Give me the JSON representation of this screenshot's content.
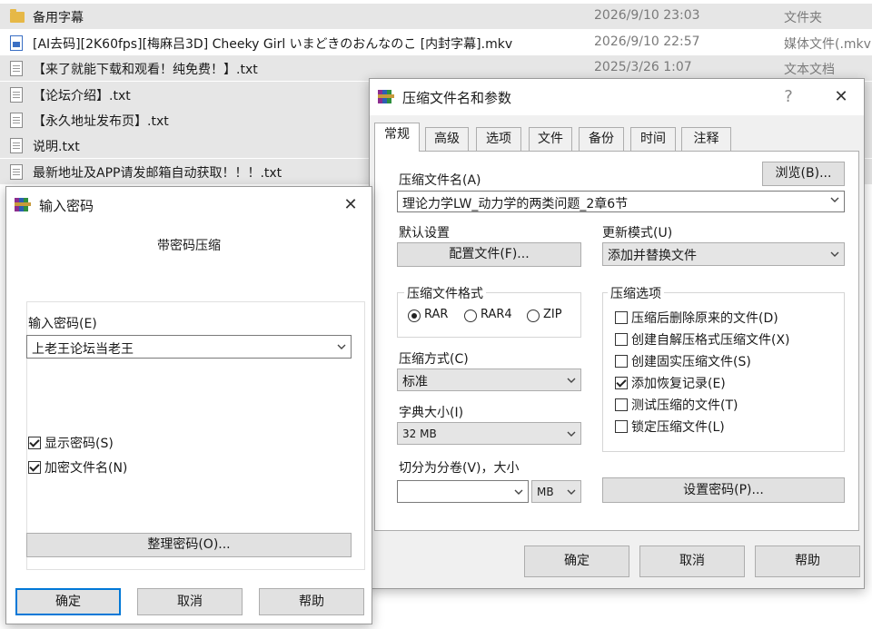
{
  "file_list": [
    {
      "name": "备用字幕",
      "date": "2026/9/10 23:03",
      "type": "文件夹",
      "icon": "folder-icon"
    },
    {
      "name": "[AI去码][2K60fps][梅麻吕3D] Cheeky Girl いまどきのおんなのこ [内封字幕].mkv",
      "date": "2026/9/10 22:57",
      "type": "媒体文件(.mkv",
      "icon": "media-file-icon"
    },
    {
      "name": "【来了就能下载和观看！纯免费！】.txt",
      "date": "2025/3/26 1:07",
      "type": "文本文档",
      "icon": "text-file-icon"
    },
    {
      "name": "【论坛介绍】.txt",
      "date": "",
      "type": "",
      "icon": "text-file-icon"
    },
    {
      "name": "【永久地址发布页】.txt",
      "date": "",
      "type": "",
      "icon": "text-file-icon"
    },
    {
      "name": "说明.txt",
      "date": "",
      "type": "",
      "icon": "text-file-icon"
    },
    {
      "name": "最新地址及APP请发邮箱自动获取！！！.txt",
      "date": "",
      "type": "",
      "icon": "text-file-icon"
    }
  ],
  "archive_dialog": {
    "title": "压缩文件名和参数",
    "help_button": "?",
    "close_button": "✕",
    "tabs": [
      "常规",
      "高级",
      "选项",
      "文件",
      "备份",
      "时间",
      "注释"
    ],
    "archive_name_label": "压缩文件名(A)",
    "browse_button": "浏览(B)...",
    "archive_name_value": "理论力学LW_动力学的两类问题_2章6节",
    "default_settings_label": "默认设置",
    "profiles_button": "配置文件(F)...",
    "update_mode_label": "更新模式(U)",
    "update_mode_value": "添加并替换文件",
    "format_group_label": "压缩文件格式",
    "formats": [
      {
        "label": "RAR",
        "selected": true
      },
      {
        "label": "RAR4",
        "selected": false
      },
      {
        "label": "ZIP",
        "selected": false
      }
    ],
    "method_label": "压缩方式(C)",
    "method_value": "标准",
    "dict_label": "字典大小(I)",
    "dict_value": "32 MB",
    "split_label": "切分为分卷(V)，大小",
    "split_value": "",
    "split_unit": "MB",
    "options_group_label": "压缩选项",
    "options": [
      {
        "label": "压缩后删除原来的文件(D)",
        "checked": false
      },
      {
        "label": "创建自解压格式压缩文件(X)",
        "checked": false
      },
      {
        "label": "创建固实压缩文件(S)",
        "checked": false
      },
      {
        "label": "添加恢复记录(E)",
        "checked": true
      },
      {
        "label": "测试压缩的文件(T)",
        "checked": false
      },
      {
        "label": "锁定压缩文件(L)",
        "checked": false
      }
    ],
    "set_password_button": "设置密码(P)...",
    "ok_button": "确定",
    "cancel_button": "取消",
    "help_label": "帮助"
  },
  "password_dialog": {
    "title": "输入密码",
    "close_button": "✕",
    "subtitle": "带密码压缩",
    "password_label": "输入密码(E)",
    "password_value": "上老王论坛当老王",
    "show_password_label": "显示密码(S)",
    "show_password_checked": true,
    "encrypt_names_label": "加密文件名(N)",
    "encrypt_names_checked": true,
    "organize_button": "整理密码(O)...",
    "ok_button": "确定",
    "cancel_button": "取消",
    "help_button": "帮助"
  },
  "colors": {
    "accent": "#0078d7",
    "selected_row": "#e6e6e6",
    "dialog_bg": "#f0f0f0"
  }
}
